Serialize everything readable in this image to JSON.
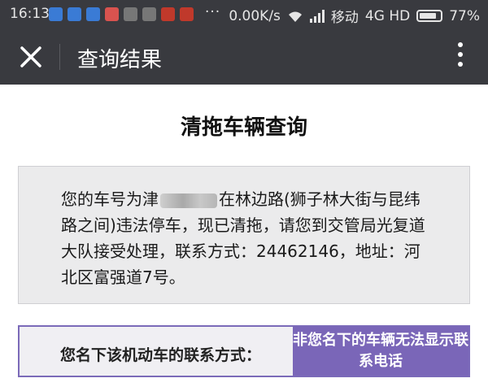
{
  "statusbar": {
    "time": "16:13",
    "overflow": "···",
    "net_speed": "0.00K/s",
    "carrier": "移动",
    "network": "4G HD",
    "battery": "77%",
    "app_icons": [
      {
        "icon": "notification-app-icon",
        "color": "#3a7bd5"
      },
      {
        "icon": "notification-app-icon",
        "color": "#3a7bd5"
      },
      {
        "icon": "notification-app-icon",
        "color": "#3a7bd5"
      },
      {
        "icon": "notification-app-icon",
        "color": "#d9534f"
      },
      {
        "icon": "notification-app-icon",
        "color": "#777777"
      },
      {
        "icon": "notification-app-icon",
        "color": "#777777"
      },
      {
        "icon": "notification-app-icon",
        "color": "#c0392b"
      },
      {
        "icon": "notification-app-icon",
        "color": "#c0392b"
      }
    ]
  },
  "appbar": {
    "title": "查询结果",
    "close_icon": "close-icon",
    "more_icon": "more-vertical-icon"
  },
  "page": {
    "title": "清拖车辆查询",
    "message": {
      "part1": "您的车号为津",
      "part2": "在林边路(狮子林大街与昆纬路之间)违法停车，现已清拖，请您到交管局光复道大队接受处理，联系方式：24462146，地址：河北区富强道7号。"
    },
    "contact_label": "您名下该机动车的联系方式：",
    "contact_button": "非您名下的车辆无法显示联系电话"
  },
  "colors": {
    "bar": "#393a3f",
    "accent": "#7a66b8",
    "box": "#ebebec"
  }
}
